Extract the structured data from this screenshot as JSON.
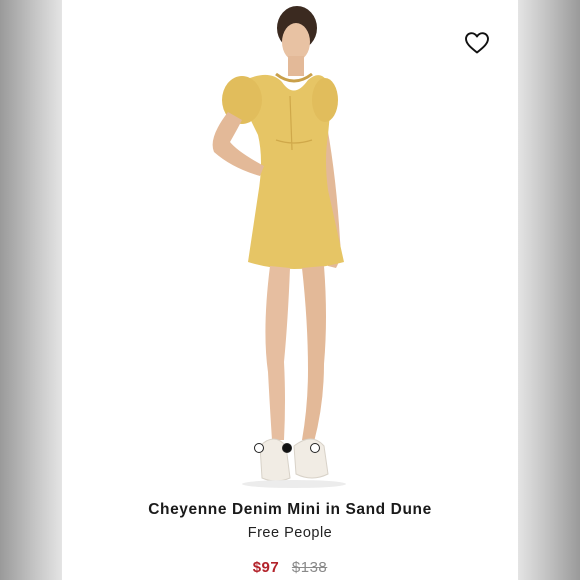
{
  "product": {
    "title": "Cheyenne Denim Mini in Sand Dune",
    "brand": "Free People",
    "sale_price": "$97",
    "original_price": "$138"
  },
  "gallery": {
    "image_count": 3,
    "active_index": 1
  },
  "icons": {
    "wishlist": "heart-outline-icon"
  },
  "colors": {
    "sale_price": "#b3232b",
    "original_price": "#8a8a8a",
    "dress": "#e6c565"
  }
}
